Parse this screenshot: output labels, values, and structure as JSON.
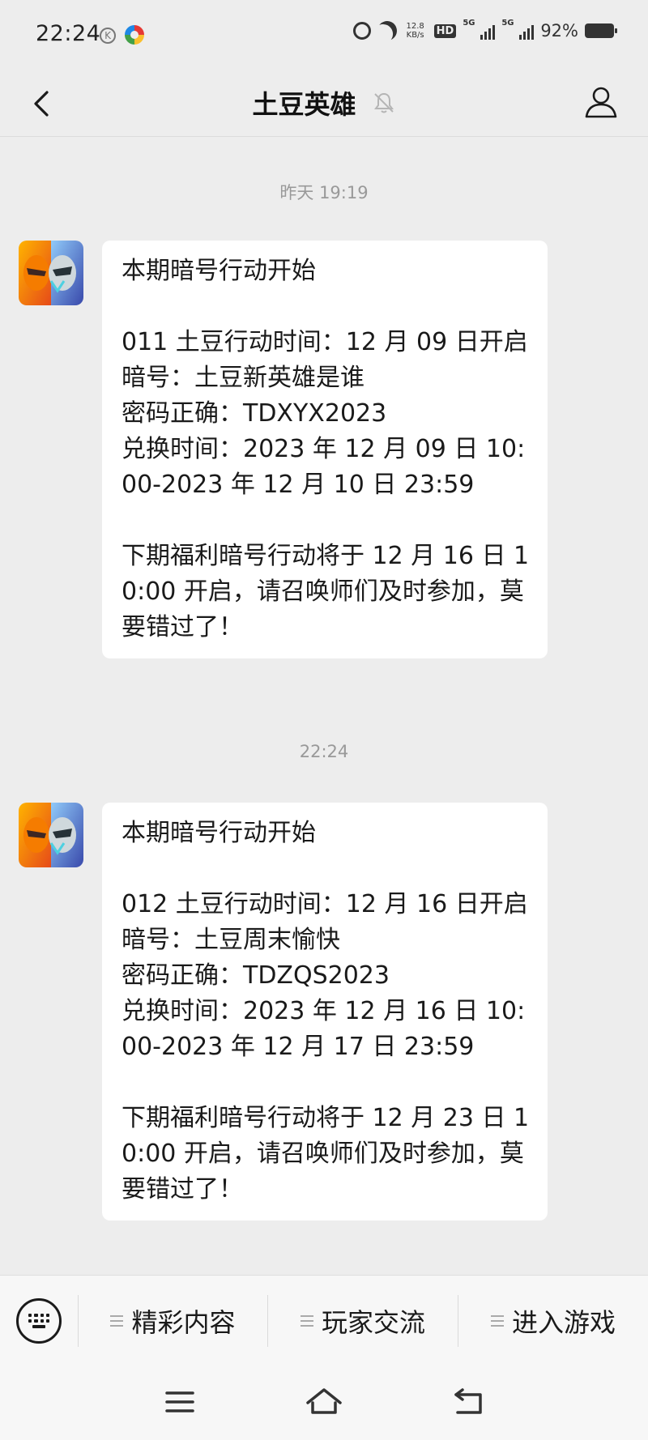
{
  "status_bar": {
    "time": "22:24",
    "k_badge": "K",
    "net_speed_value": "12.8",
    "net_speed_unit": "KB/s",
    "hd": "HD",
    "signal1_label": "5G",
    "signal2_label": "5G",
    "battery": "92%"
  },
  "header": {
    "title": "土豆英雄"
  },
  "messages": [
    {
      "timestamp": "昨天 19:19",
      "lines": [
        "本期暗号行动开始",
        "",
        "011 土豆行动时间：12 月 09 日开启",
        "暗号：土豆新英雄是谁",
        "密码正确：TDXYX2023",
        "兑换时间：2023 年 12 月 09 日 10:00-2023 年 12 月 10 日 23:59",
        "",
        "下期福利暗号行动将于 12 月 16 日 10:00 开启，请召唤师们及时参加，莫要错过了！"
      ]
    },
    {
      "timestamp": "22:24",
      "lines": [
        "本期暗号行动开始",
        "",
        "012 土豆行动时间：12 月 16 日开启",
        "暗号：土豆周末愉快",
        "密码正确：TDZQS2023",
        "兑换时间：2023 年 12 月 16 日 10:00-2023 年 12 月 17 日 23:59",
        "",
        "下期福利暗号行动将于 12 月 23 日 10:00 开启，请召唤师们及时参加，莫要错过了！"
      ]
    }
  ],
  "bottom_menu": {
    "items": [
      "精彩内容",
      "玩家交流",
      "进入游戏"
    ]
  },
  "colors": {
    "background": "#ededed",
    "bubble": "#ffffff",
    "timestamp": "#999999",
    "text": "#1a1a1a"
  }
}
